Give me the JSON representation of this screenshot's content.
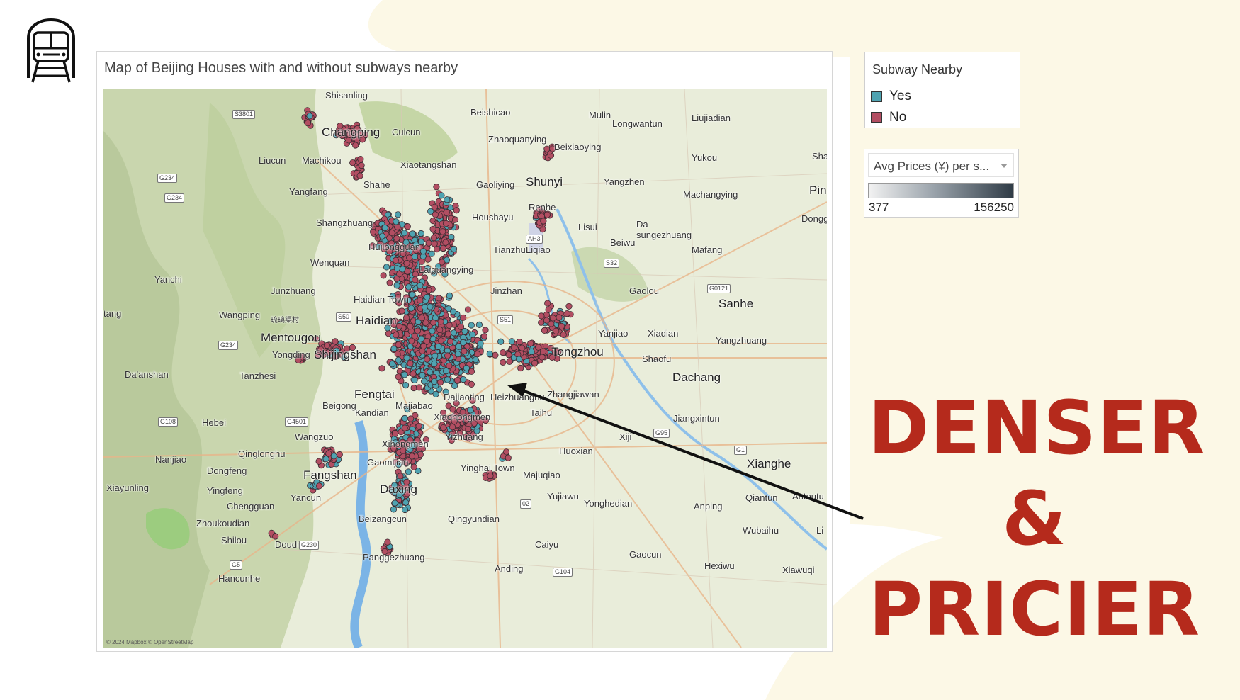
{
  "slide": {
    "background_color": "#ffffff",
    "blob_color": "#fcf8e6",
    "logo_icon": "train-icon"
  },
  "map": {
    "title": "Map of Beijing Houses with and without subways nearby",
    "credit": "© 2024 Mapbox © OpenStreetMap",
    "place_labels": [
      "Shisanling",
      "Beishicao",
      "Mulin",
      "Longwantun",
      "Liujiadian",
      "Changping",
      "Cuicun",
      "Zhaoquanying",
      "Beixiaoying",
      "Liucun",
      "Machikou",
      "Xiaotangshan",
      "Yukou",
      "Sha",
      "Yangfang",
      "Shahe",
      "Gaoliying",
      "Shunyi",
      "Yangzhen",
      "Machangying",
      "Pin",
      "Renhe",
      "Shangzhuang",
      "Houshayu",
      "Lisui",
      "Da sungezhuang",
      "Dongga",
      "Huilongguan",
      "Tianzhu",
      "Liqiao",
      "Beiwu",
      "Mafang",
      "Wenquan",
      "Laiguangying",
      "Yanchi",
      "Junzhuang",
      "Jinzhan",
      "Gaolou",
      "Haidian Town",
      "Sanhe",
      "Wangping",
      "琉璃渠村",
      "Haidian",
      "Mentougou",
      "Yanjiao",
      "Xiadian",
      "Yangzhuang",
      "Yongding",
      "Shijingshan",
      "Tongzhou",
      "Shaofu",
      "Da'anshan",
      "Tanzhesi",
      "Dachang",
      "Fengtai",
      "Heizhuanghu",
      "Zhangjiawan",
      "Beigong",
      "Kandian",
      "Majiabao",
      "Dajiaoting",
      "Xiaohongmen",
      "Taihu",
      "Jiangxintun",
      "Hebei",
      "Wangzuo",
      "Xihongmen",
      "Xiji",
      "Nanjiao",
      "Qinglonghu",
      "Yizhuang",
      "Huoxian",
      "Gaomijian",
      "Xianghe",
      "Dongfeng",
      "Fangshan",
      "Yinghai Town",
      "Majuqiao",
      "Xiayunling",
      "Yingfeng",
      "Yancun",
      "Daxing",
      "Yujiawu",
      "Qiantun",
      "Antoutu",
      "Chengguan",
      "Yonghedian",
      "Anping",
      "Zhoukoudian",
      "Beizangcun",
      "Qingyundian",
      "Wubaihu",
      "Li",
      "Shilou",
      "Doudian",
      "Caiyu",
      "Gaocun",
      "Panggezhuang",
      "Hexiwu",
      "Anding",
      "Xiawuqi",
      "Hancunhe",
      "tang"
    ],
    "road_shields": [
      "S3801",
      "G234",
      "G234",
      "S50",
      "S51",
      "AH3",
      "S32",
      "G0121",
      "G234",
      "G108",
      "G4501",
      "G95",
      "G1",
      "G230",
      "G5",
      "02",
      "G104"
    ],
    "legend_subway": {
      "title": "Subway Nearby",
      "items": [
        {
          "label": "Yes",
          "color": "#4fa3b1"
        },
        {
          "label": "No",
          "color": "#b24e62"
        }
      ]
    },
    "legend_price": {
      "title": "Avg Prices (¥) per s...",
      "min": "377",
      "max": "156250",
      "gradient_start": "#f2f2f2",
      "gradient_end": "#2f3b46"
    },
    "point_colors": {
      "subway_yes": "#4fa3b1",
      "subway_no": "#b24e62",
      "outline": "#3a2a30"
    }
  },
  "headline": {
    "line1": "DENSER",
    "line2": "&",
    "line3": "PRICIER",
    "color": "#b52a1c"
  }
}
